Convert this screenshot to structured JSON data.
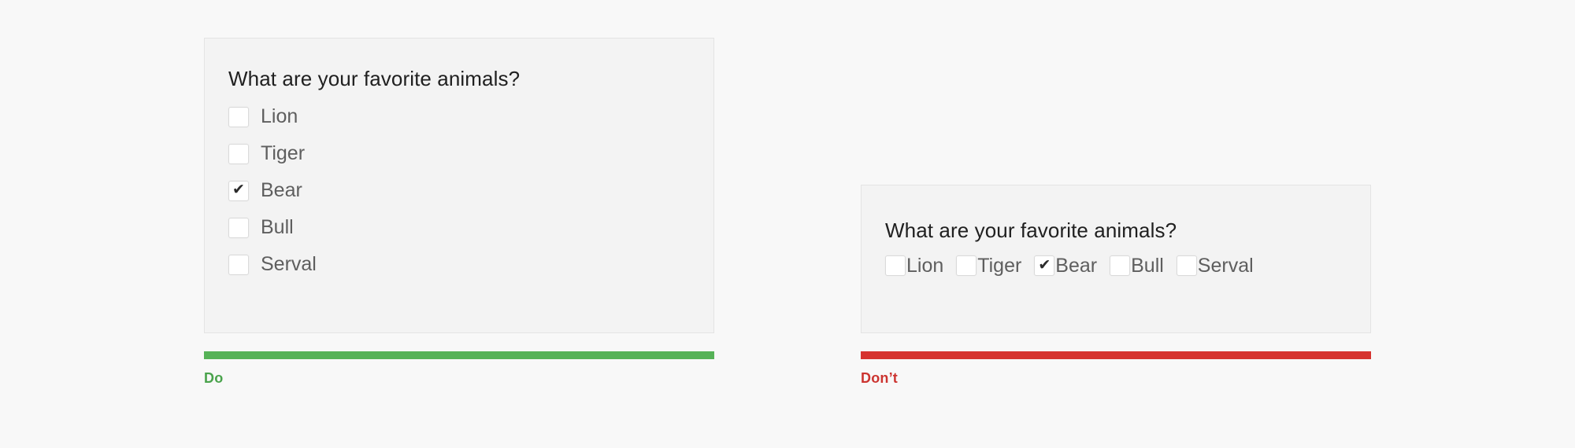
{
  "page": {
    "background_color": "#f8f8f8"
  },
  "examples": [
    {
      "id": "do",
      "panel": {
        "heading": "What are your favorite animals?",
        "layout": "vertical",
        "options": [
          {
            "label": "Lion",
            "checked": false,
            "check_glyph": "✔"
          },
          {
            "label": "Tiger",
            "checked": false,
            "check_glyph": "✔"
          },
          {
            "label": "Bear",
            "checked": true,
            "check_glyph": "✔"
          },
          {
            "label": "Bull",
            "checked": false,
            "check_glyph": "✔"
          },
          {
            "label": "Serval",
            "checked": false,
            "check_glyph": "✔"
          }
        ]
      },
      "marker": {
        "label": "Do",
        "bar_color": "#56b257",
        "label_color": "#4aa34c"
      }
    },
    {
      "id": "dont",
      "panel": {
        "heading": "What are your favorite animals?",
        "layout": "horizontal",
        "options": [
          {
            "label": "Lion",
            "checked": false,
            "check_glyph": "✔"
          },
          {
            "label": "Tiger",
            "checked": false,
            "check_glyph": "✔"
          },
          {
            "label": "Bear",
            "checked": true,
            "check_glyph": "✔"
          },
          {
            "label": "Bull",
            "checked": false,
            "check_glyph": "✔"
          },
          {
            "label": "Serval",
            "checked": false,
            "check_glyph": "✔"
          }
        ]
      },
      "marker": {
        "label": "Don’t",
        "bar_color": "#d6332f",
        "label_color": "#cc3430"
      }
    }
  ]
}
